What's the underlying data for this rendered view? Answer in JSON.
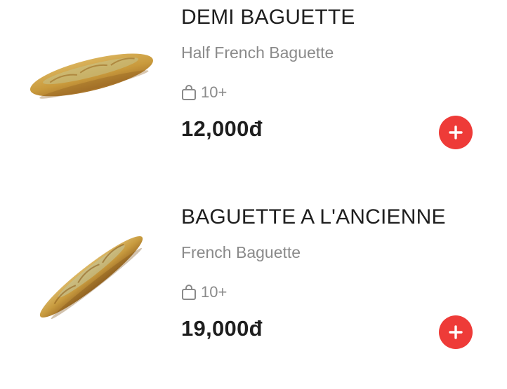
{
  "products": [
    {
      "name": "DEMI BAGUETTE",
      "subtitle": "Half French Baguette",
      "stock_icon": "shopping-bag-icon",
      "stock": "10+",
      "price": "12,000đ",
      "add_icon": "plus-icon"
    },
    {
      "name": "BAGUETTE A L'ANCIENNE",
      "subtitle": "French Baguette",
      "stock_icon": "shopping-bag-icon",
      "stock": "10+",
      "price": "19,000đ",
      "add_icon": "plus-icon"
    }
  ],
  "colors": {
    "accent": "#ee3b38",
    "text_primary": "#1e1e1e",
    "text_secondary": "#8a8a8a"
  }
}
